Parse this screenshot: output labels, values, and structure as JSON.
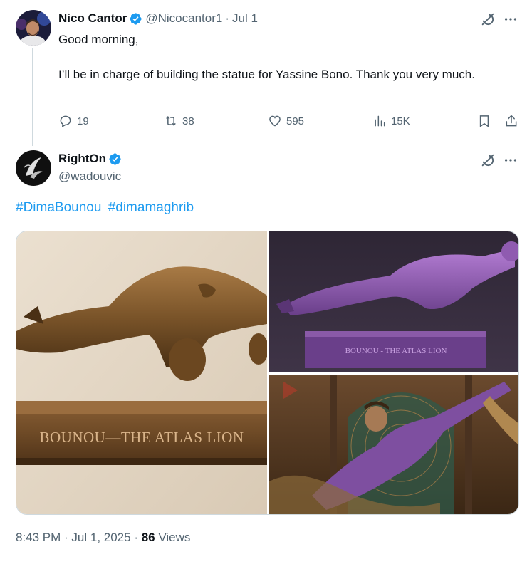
{
  "tweet1": {
    "name": "Nico Cantor",
    "handle": "@Nicocantor1",
    "separator": "·",
    "date": "Jul 1",
    "greeting": "Good morning,",
    "body": "I’ll be in charge of building the statue for Yassine Bono. Thank you very much.",
    "replies": "19",
    "retweets": "38",
    "likes": "595",
    "views": "15K"
  },
  "tweet2": {
    "name": "RightOn",
    "handle": "@wadouvic",
    "hashtags": [
      "#DimaBounou",
      "#dimamaghrib"
    ],
    "images": [
      {
        "alt": "Bronze statue of goalkeeper diving above plaque",
        "plaque": "BOUNOU—THE ATLAS LION"
      },
      {
        "alt": "Purple statue of goalkeeper number 23 diving",
        "plaque": "BOUNOU - THE ATLAS LION"
      },
      {
        "alt": "Statue of goalkeeper in purple kit diving before Moroccan archway"
      }
    ],
    "timestamp": "8:43 PM · Jul 1, 2025 · ",
    "views_count": "86",
    "views_label": " Views"
  },
  "colors": {
    "accent": "#1d9bf0",
    "text": "#0f1419",
    "muted": "#536471",
    "verified": "#1d9bf0"
  },
  "icons": [
    "verified-badge-icon",
    "grok-icon",
    "more-icon",
    "reply-icon",
    "retweet-icon",
    "like-icon",
    "views-icon",
    "bookmark-icon",
    "share-icon"
  ]
}
